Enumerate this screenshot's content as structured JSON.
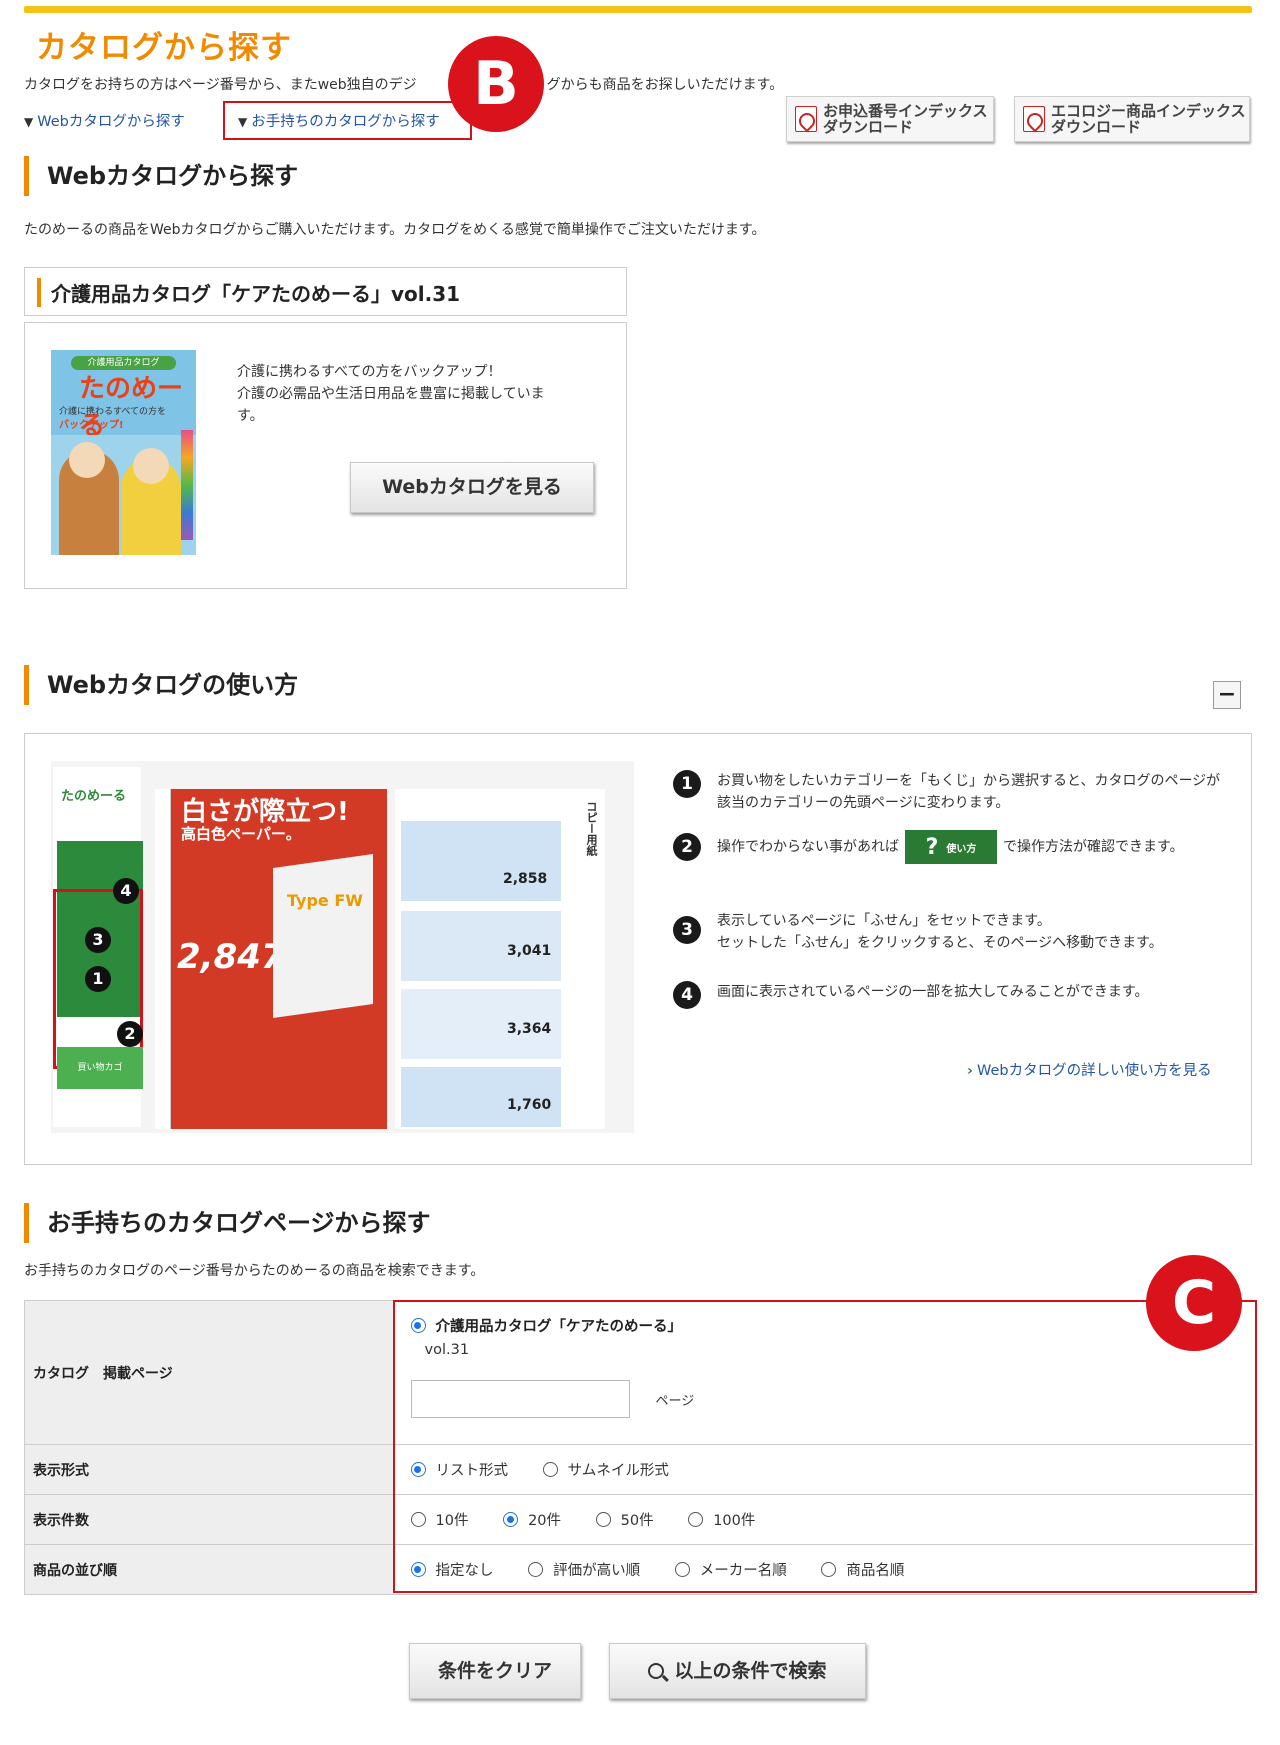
{
  "page": {
    "title": "カタログから探す",
    "intro": "カタログをお持ちの方はページ番号から、またweb独自のデジ",
    "intro_tail": "グからも商品をお探しいただけます。",
    "nav_web": "Webカタログから探す",
    "nav_own": "お手持ちのカタログから探す",
    "dl1_line1": "お申込番号インデックス",
    "dl1_line2": "ダウンロード",
    "dl2_line1": "エコロジー商品インデックス",
    "dl2_line2": "ダウンロード"
  },
  "annotations": {
    "b": "B",
    "c": "C"
  },
  "web_section": {
    "heading": "Webカタログから探す",
    "desc": "たのめーるの商品をWebカタログからご購入いただけます。カタログをめくる感覚で簡単操作でご注文いただけます。",
    "catalog_title": "介護用品カタログ「ケアたのめーる」vol.31",
    "catalog_desc_1": "介護に携わるすべての方をバックアップ！",
    "catalog_desc_2": "介護の必需品や生活日用品を豊富に掲載していま",
    "catalog_desc_3": "す。",
    "view_button": "Webカタログを見る",
    "cover_label": "介護用品カタログ",
    "cover_title": "たのめーる",
    "cover_sub": "介護に携わるすべての方を",
    "cover_sub2": "バックアップ!"
  },
  "howto": {
    "heading": "Webカタログの使い方",
    "collapse": "−",
    "steps": [
      {
        "num": "1",
        "text": "お買い物をしたいカテゴリーを「もくじ」から選択すると、カタログのページが該当のカテゴリーの先頭ページに変わります。"
      },
      {
        "num": "2",
        "text_a": "操作でわからない事があれば",
        "btn": "使い方",
        "text_b": "で操作方法が確認できます。"
      },
      {
        "num": "3",
        "text": "表示しているページに「ふせん」をセットできます。",
        "text2": "セットした「ふせん」をクリックすると、そのページへ移動できます。"
      },
      {
        "num": "4",
        "text": "画面に表示されているページの一部を拡大してみることができます。"
      }
    ],
    "more_link": "Webカタログの詳しい使い方を見る",
    "shot": {
      "logo": "たのめーる",
      "headline": "白さが際立つ!",
      "sub": "高白色ペーパー。",
      "price": "2,847",
      "brand": "Type FW",
      "prices": [
        "2,858",
        "3,041",
        "3,364",
        "1,760"
      ],
      "side": "コピー用紙",
      "cart": "買い物カゴ"
    }
  },
  "search": {
    "heading": "お手持ちのカタログページから探す",
    "desc": "お手持ちのカタログのページ番号からたのめーるの商品を検索できます。",
    "row1_label": "カタログ　掲載ページ",
    "catalog_option": "介護用品カタログ「ケアたのめーる」",
    "catalog_vol": "vol.31",
    "page_unit": "ページ",
    "page_value": "",
    "row2_label": "表示形式",
    "display_options": [
      "リスト形式",
      "サムネイル形式"
    ],
    "row3_label": "表示件数",
    "count_options": [
      "10件",
      "20件",
      "50件",
      "100件"
    ],
    "row4_label": "商品の並び順",
    "sort_options": [
      "指定なし",
      "評価が高い順",
      "メーカー名順",
      "商品名順"
    ],
    "clear_button": "条件をクリア",
    "search_button": "以上の条件で検索"
  }
}
